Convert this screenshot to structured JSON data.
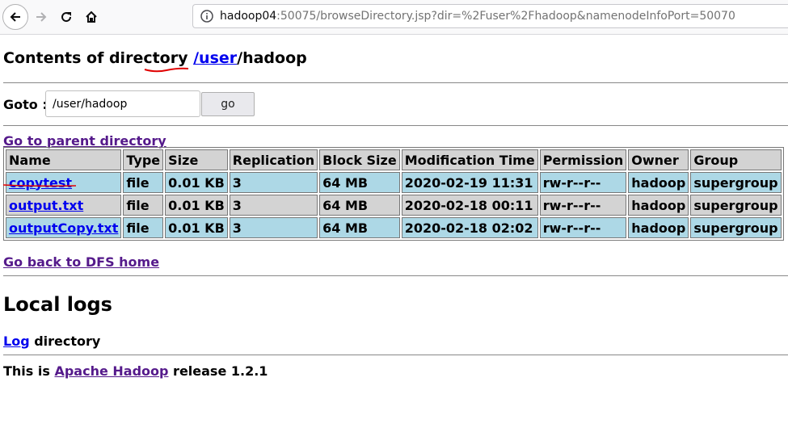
{
  "browser": {
    "url_host": "hadoop04",
    "url_rest": ":50075/browseDirectory.jsp?dir=%2Fuser%2Fhadoop&namenodeInfoPort=50070"
  },
  "header": {
    "prefix": "Contents of directory ",
    "path_link": "/user",
    "path_rest": "/hadoop"
  },
  "goto": {
    "label": "Goto : ",
    "value": "/user/hadoop",
    "button_label": "go"
  },
  "parent_link": "Go to parent directory",
  "table": {
    "headers": [
      "Name",
      "Type",
      "Size",
      "Replication",
      "Block Size",
      "Modification Time",
      "Permission",
      "Owner",
      "Group"
    ],
    "rows": [
      [
        "copytest",
        "file",
        "0.01 KB",
        "3",
        "64 MB",
        "2020-02-19 11:31",
        "rw-r--r--",
        "hadoop",
        "supergroup"
      ],
      [
        "output.txt",
        "file",
        "0.01 KB",
        "3",
        "64 MB",
        "2020-02-18 00:11",
        "rw-r--r--",
        "hadoop",
        "supergroup"
      ],
      [
        "outputCopy.txt",
        "file",
        "0.01 KB",
        "3",
        "64 MB",
        "2020-02-18 02:02",
        "rw-r--r--",
        "hadoop",
        "supergroup"
      ]
    ]
  },
  "dfs_home_link": "Go back to DFS home",
  "logs": {
    "title": "Local logs",
    "log_link": "Log",
    "log_suffix": " directory"
  },
  "footer": {
    "prefix": "This is ",
    "link": "Apache Hadoop",
    "suffix": " release 1.2.1"
  },
  "colors": {
    "row_blue": "#add8e6",
    "row_gray": "#d3d3d3",
    "link": "#0000ee",
    "visited_link": "#551a8b",
    "annotation_red": "#e00000"
  }
}
